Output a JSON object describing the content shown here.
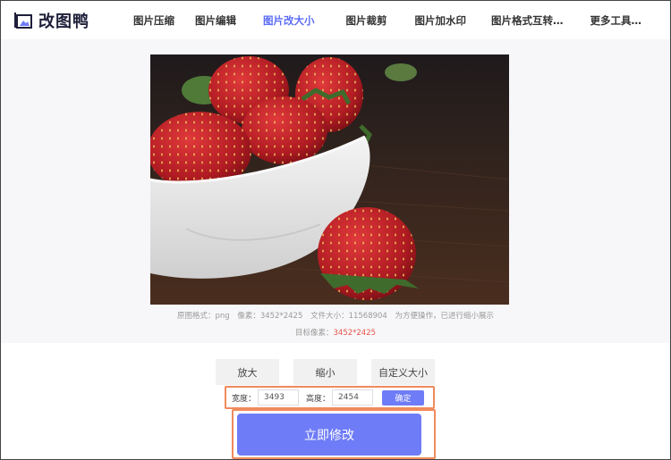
{
  "brand": {
    "name": "改图鸭"
  },
  "nav": {
    "items": [
      {
        "label": "图片压缩",
        "active": false
      },
      {
        "label": "图片编辑",
        "active": false
      },
      {
        "label": "图片改大小",
        "active": true
      },
      {
        "label": "图片裁剪",
        "active": false
      },
      {
        "label": "图片加水印",
        "active": false
      },
      {
        "label": "图片格式互转…",
        "active": false
      },
      {
        "label": "更多工具…",
        "active": false
      }
    ]
  },
  "image_info": {
    "format": "原图格式：png",
    "pixels": "像素：3452*2425",
    "filesize": "文件大小：11568904",
    "note": "为方便操作，已进行缩小展示",
    "target_label": "目标像素：",
    "target_value": "3452*2425"
  },
  "modes": {
    "enlarge": "放大",
    "shrink": "缩小",
    "custom": "自定义大小"
  },
  "dimensions": {
    "width_label": "宽度：",
    "width_value": "3493",
    "height_label": "高度：",
    "height_value": "2454",
    "confirm_label": "确定"
  },
  "submit": {
    "label": "立即修改"
  },
  "colors": {
    "accent": "#6f7cf7",
    "nav_active": "#5b6cf6",
    "highlight_border": "#f08a5d",
    "target_value": "#e8524a",
    "image_bg": "#3a2a22"
  }
}
